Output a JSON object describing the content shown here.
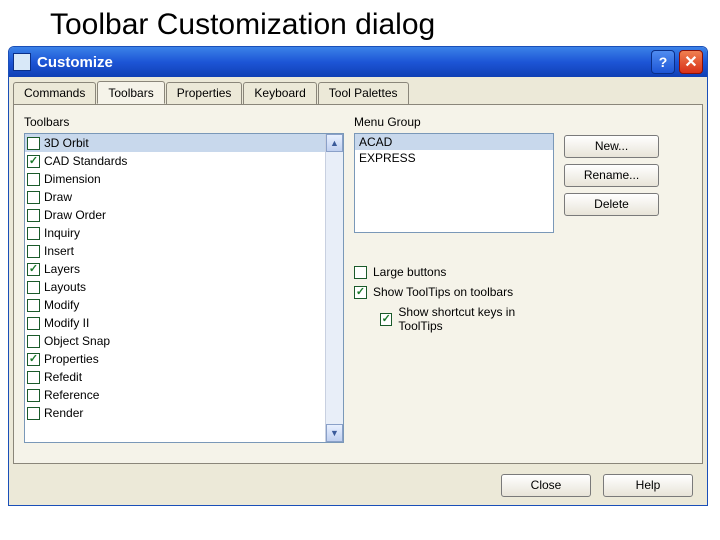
{
  "page_heading": "Toolbar Customization dialog",
  "window": {
    "title": "Customize"
  },
  "tabs": [
    {
      "label": "Commands"
    },
    {
      "label": "Toolbars"
    },
    {
      "label": "Properties"
    },
    {
      "label": "Keyboard"
    },
    {
      "label": "Tool Palettes"
    }
  ],
  "active_tab": 1,
  "toolbars_section_label": "Toolbars",
  "menugroup_section_label": "Menu Group",
  "toolbar_items": [
    {
      "label": "3D Orbit",
      "checked": false,
      "selected": true
    },
    {
      "label": "CAD Standards",
      "checked": true
    },
    {
      "label": "Dimension",
      "checked": false
    },
    {
      "label": "Draw",
      "checked": false
    },
    {
      "label": "Draw Order",
      "checked": false
    },
    {
      "label": "Inquiry",
      "checked": false
    },
    {
      "label": "Insert",
      "checked": false
    },
    {
      "label": "Layers",
      "checked": true
    },
    {
      "label": "Layouts",
      "checked": false
    },
    {
      "label": "Modify",
      "checked": false
    },
    {
      "label": "Modify II",
      "checked": false
    },
    {
      "label": "Object Snap",
      "checked": false
    },
    {
      "label": "Properties",
      "checked": true
    },
    {
      "label": "Refedit",
      "checked": false
    },
    {
      "label": "Reference",
      "checked": false
    },
    {
      "label": "Render",
      "checked": false
    }
  ],
  "menu_groups": [
    {
      "label": "ACAD",
      "selected": true
    },
    {
      "label": "EXPRESS",
      "selected": false
    }
  ],
  "options": {
    "large_buttons": {
      "label": "Large buttons",
      "checked": false
    },
    "show_tooltips": {
      "label": "Show ToolTips on toolbars",
      "checked": true
    },
    "show_shortcut": {
      "label": "Show shortcut keys in ToolTips",
      "checked": true
    }
  },
  "buttons": {
    "new": "New...",
    "rename": "Rename...",
    "delete": "Delete",
    "close": "Close",
    "help": "Help"
  }
}
